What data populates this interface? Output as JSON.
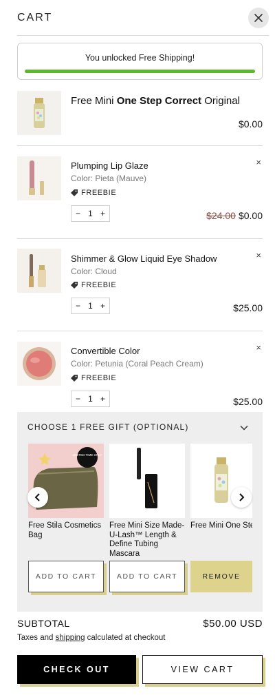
{
  "header": {
    "title": "CART"
  },
  "shipping": {
    "message": "You unlocked Free Shipping!",
    "progress": 1.0,
    "bar_color": "#5cb82e"
  },
  "items": [
    {
      "name_pre": "Free Mini ",
      "name_bold": "One Step Correct",
      "name_post": " Original",
      "price": "$0.00"
    },
    {
      "name": "Plumping Lip Glaze",
      "color": "Color: Pieta (Mauve)",
      "tag": "FREEBIE",
      "qty": "1",
      "old_price": "$24.00",
      "price": "$0.00"
    },
    {
      "name": "Shimmer & Glow Liquid Eye Shadow",
      "color": "Color: Cloud",
      "tag": "FREEBIE",
      "qty": "1",
      "price": "$25.00"
    },
    {
      "name": "Convertible Color",
      "color": "Color: Petunia (Coral Peach Cream)",
      "tag": "FREEBIE",
      "qty": "1",
      "price": "$25.00"
    }
  ],
  "qty_controls": {
    "minus": "−",
    "plus": "+"
  },
  "remove_symbol": "×",
  "gift": {
    "header": "CHOOSE 1 FREE GIFT (OPTIONAL)",
    "badge": "LIMITED TIME ONLY",
    "options": [
      {
        "name": "Free Stila Cosmetics Bag",
        "button": "ADD TO CART"
      },
      {
        "name": "Free Mini Size Made-U-Lash™ Length & Define Tubing Mascara",
        "button": "ADD TO CART"
      },
      {
        "name": "Free Mini One Step Correct Original",
        "button": "REMOVE"
      }
    ]
  },
  "summary": {
    "subtotal_label": "SUBTOTAL",
    "subtotal_value": "$50.00 USD",
    "tax_pre": "Taxes and ",
    "tax_link": "shipping",
    "tax_post": " calculated at checkout"
  },
  "actions": {
    "checkout": "CHECK OUT",
    "view_cart": "VIEW CART"
  },
  "colors": {
    "accent_shadow": "#d8cf8e",
    "remove_button": "#ddd38d"
  }
}
